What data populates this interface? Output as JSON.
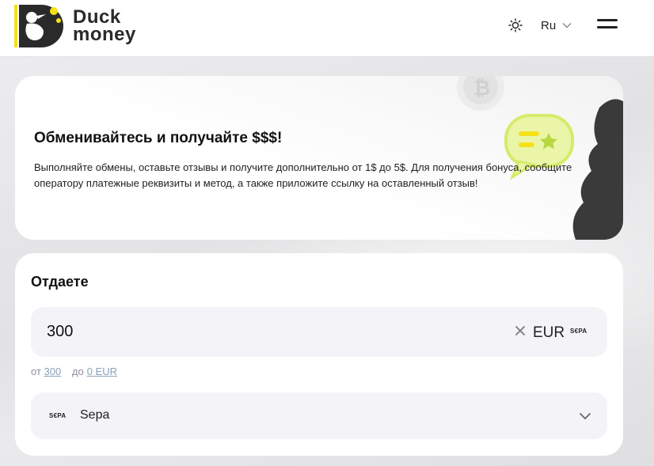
{
  "brand": {
    "line1": "Duck",
    "line2": "money"
  },
  "header": {
    "language": "Ru"
  },
  "promo": {
    "title": "Обменивайтесь и получайте $$$!",
    "text": "Выполняйте обмены, оставьте отзывы и получите дополнительно от 1$ до 5$. Для получения бонуса, сообщите оператору платежные реквизиты и метод, а также приложите ссылку на оставленный отзыв!"
  },
  "give": {
    "title": "Отдаете",
    "amount": "300",
    "currency": "EUR",
    "currency_badge": "S€PA",
    "limits": {
      "from_label": "от",
      "min": "300",
      "to_label": "до",
      "max": "0 EUR"
    },
    "method": {
      "badge": "S€PA",
      "label": "Sepa"
    }
  },
  "colors": {
    "accent_yellow": "#f5e11a",
    "dark": "#2a2a2a",
    "field_bg": "#f4f4f8"
  },
  "icons": [
    "duck-logo-icon",
    "sun-icon",
    "chevron-down-icon",
    "hamburger-menu-icon",
    "close-icon",
    "chat-star-icon",
    "bitcoin-coin-icon"
  ]
}
